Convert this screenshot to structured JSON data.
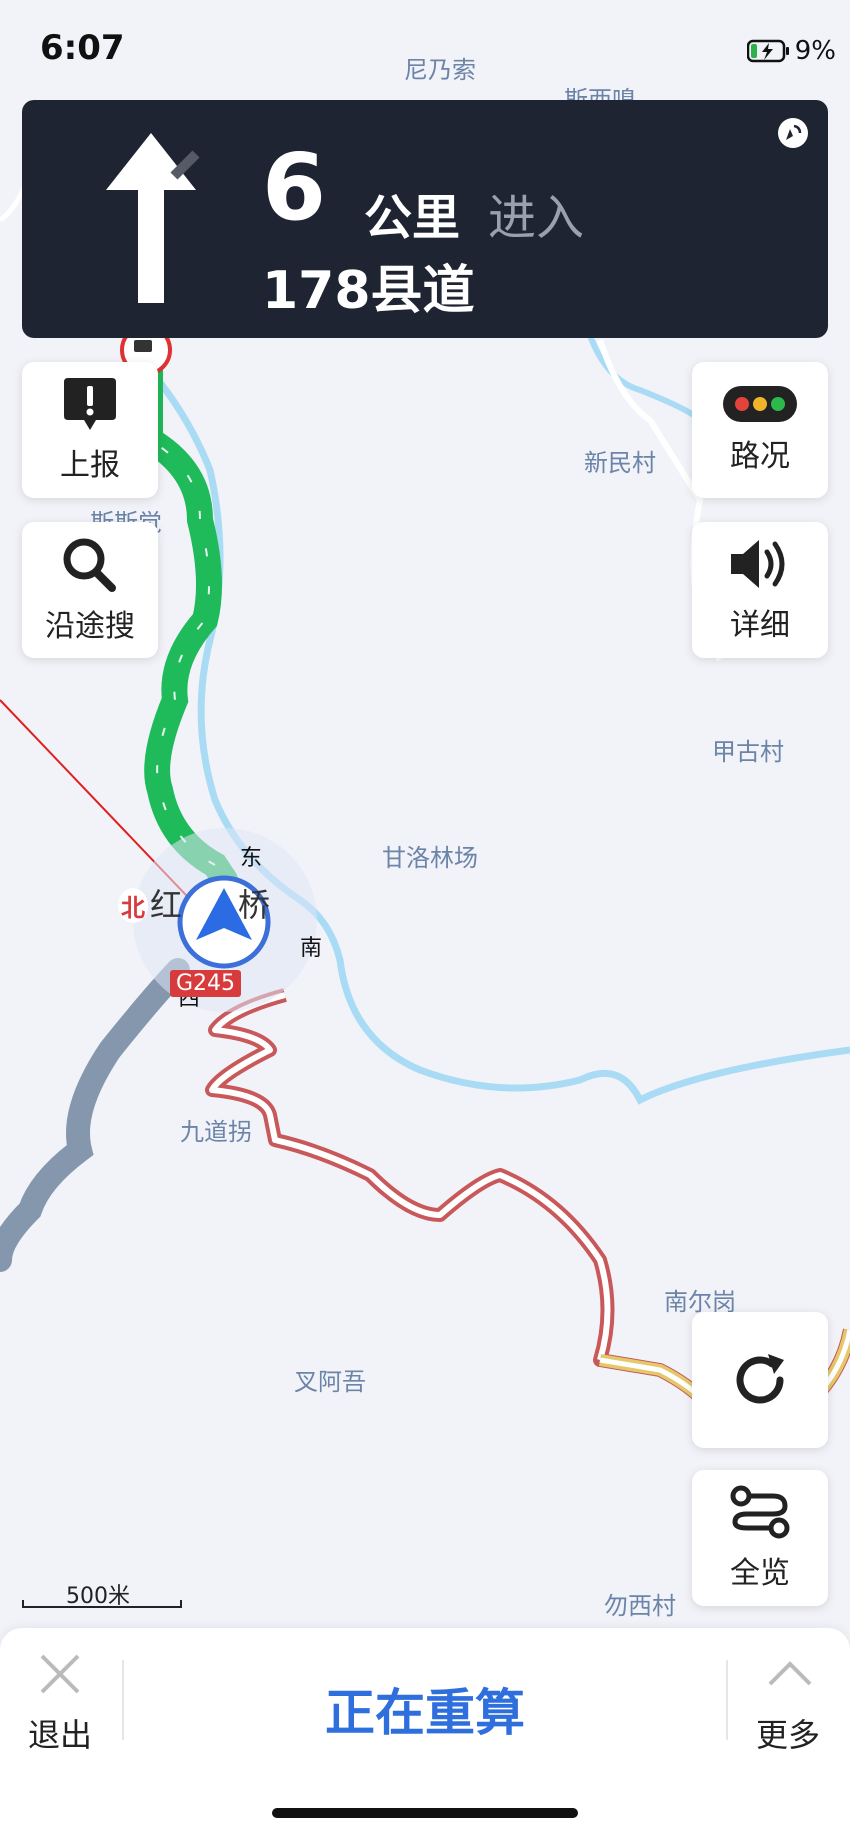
{
  "status_bar": {
    "time": "6:07",
    "battery_percent": "9%"
  },
  "nav_banner": {
    "distance_value": "6",
    "distance_unit": "公里",
    "action": "进入",
    "road_name": "178县道",
    "turn_icon": "straight-arrow-icon",
    "gps_icon": "gps-signal-icon"
  },
  "left_buttons": [
    {
      "label": "上报",
      "icon": "report-icon"
    },
    {
      "label": "沿途搜",
      "icon": "search-icon"
    }
  ],
  "right_buttons": [
    {
      "label": "路况",
      "icon": "traffic-light-icon"
    },
    {
      "label": "详细",
      "icon": "speaker-icon"
    }
  ],
  "map_labels": {
    "nainaisuo": "尼乃索",
    "sixiyan": "斯西嗅",
    "xinmincun": "新民村",
    "sisichang": "斯斯觉",
    "jiagucun": "甲古村",
    "ganluolinchang": "甘洛林场",
    "hongqiao": "红桥",
    "jiudaoguai": "九道拐",
    "nanergang": "南尔岗",
    "chaawu": "叉阿吾",
    "wuxicun": "勿西村"
  },
  "compass": {
    "east": "东",
    "south": "南",
    "west": "西",
    "north": "北"
  },
  "road_tag": "G245",
  "scale_label": "500米",
  "right_bottom_buttons": [
    {
      "icon": "refresh-icon"
    },
    {
      "label": "全览",
      "icon": "route-overview-icon"
    }
  ],
  "bottom_bar": {
    "exit_label": "退出",
    "status_text": "正在重算",
    "more_label": "更多"
  },
  "colors": {
    "banner_bg": "#1f2433",
    "route_green": "#1fba5a",
    "route_red": "#c9585a",
    "route_grey": "#8497ad",
    "river": "#a9dcf4",
    "accent_blue": "#2f6fdd"
  }
}
